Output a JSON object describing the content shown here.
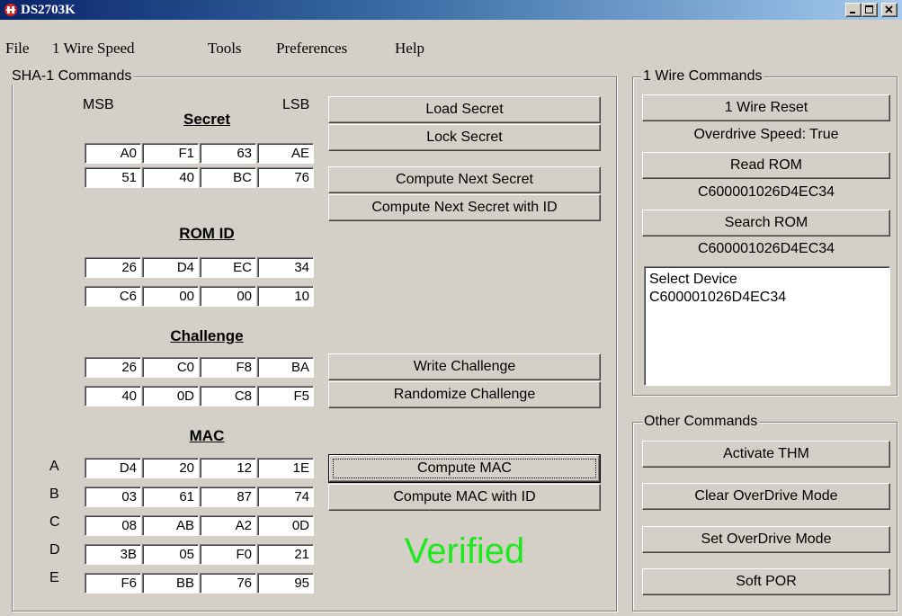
{
  "window": {
    "title": "DS2703K"
  },
  "menu": [
    "File",
    "1 Wire Speed",
    "Tools",
    "Preferences",
    "Help"
  ],
  "sha": {
    "legend": "SHA-1 Commands",
    "msb": "MSB",
    "lsb": "LSB",
    "secret": {
      "title": "Secret",
      "rows": [
        [
          "A0",
          "F1",
          "63",
          "AE"
        ],
        [
          "51",
          "40",
          "BC",
          "76"
        ]
      ]
    },
    "romid": {
      "title": "ROM ID",
      "rows": [
        [
          "26",
          "D4",
          "EC",
          "34"
        ],
        [
          "C6",
          "00",
          "00",
          "10"
        ]
      ]
    },
    "challenge": {
      "title": "Challenge",
      "rows": [
        [
          "26",
          "C0",
          "F8",
          "BA"
        ],
        [
          "40",
          "0D",
          "C8",
          "F5"
        ]
      ]
    },
    "mac": {
      "title": "MAC",
      "row_labels": [
        "A",
        "B",
        "C",
        "D",
        "E"
      ],
      "rows": [
        [
          "D4",
          "20",
          "12",
          "1E"
        ],
        [
          "03",
          "61",
          "87",
          "74"
        ],
        [
          "08",
          "AB",
          "A2",
          "0D"
        ],
        [
          "3B",
          "05",
          "F0",
          "21"
        ],
        [
          "F6",
          "BB",
          "76",
          "95"
        ]
      ]
    },
    "buttons": {
      "load_secret": "Load Secret",
      "lock_secret": "Lock Secret",
      "compute_next_secret": "Compute Next Secret",
      "compute_next_secret_id": "Compute Next Secret with ID",
      "write_challenge": "Write Challenge",
      "randomize_challenge": "Randomize Challenge",
      "compute_mac": "Compute MAC",
      "compute_mac_id": "Compute MAC with ID"
    },
    "status": "Verified",
    "status_color": "#1ee81e"
  },
  "onewire": {
    "legend": "1 Wire Commands",
    "reset_button": "1 Wire Reset",
    "overdrive_status": "Overdrive Speed: True",
    "read_rom_button": "Read ROM",
    "read_rom_value": "C600001026D4EC34",
    "search_rom_button": "Search ROM",
    "search_rom_value": "C600001026D4EC34",
    "listbox": [
      "Select Device",
      "C600001026D4EC34"
    ]
  },
  "other": {
    "legend": "Other Commands",
    "activate_thm": "Activate THM",
    "clear_overdrive": "Clear OverDrive Mode",
    "set_overdrive": "Set OverDrive Mode",
    "soft_por": "Soft POR"
  }
}
